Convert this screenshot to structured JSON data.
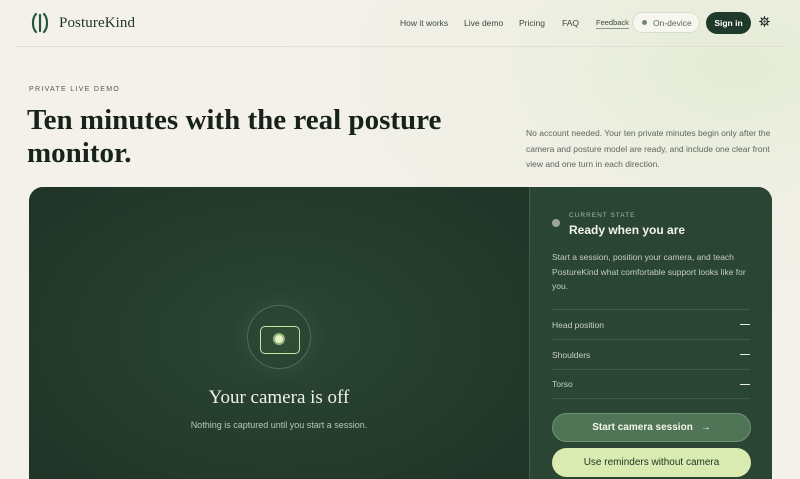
{
  "brand": {
    "name": "PostureKind"
  },
  "nav": {
    "links": [
      "How it works",
      "Live demo",
      "Pricing",
      "FAQ"
    ],
    "feedback": "Feedback",
    "status_badge": "On-device",
    "signin": "Sign in",
    "settings_icon": "gear-icon"
  },
  "hero": {
    "eyebrow": "PRIVATE LIVE DEMO",
    "headline": "Ten minutes with the real posture monitor.",
    "subtext": "No account needed. Your ten private minutes begin only after the camera and posture model are ready, and include one clear front view and one turn in each direction."
  },
  "camera": {
    "icon": "camera-icon",
    "title": "Your camera is off",
    "subtitle": "Nothing is captured until you start a session."
  },
  "state": {
    "label": "CURRENT STATE",
    "title": "Ready when you are",
    "description": "Start a session, position your camera, and teach PostureKind what comfortable support looks like for you."
  },
  "metrics": [
    {
      "label": "Head position",
      "value": "—"
    },
    {
      "label": "Shoulders",
      "value": "—"
    },
    {
      "label": "Torso",
      "value": "—"
    }
  ],
  "actions": {
    "start": "Start camera session",
    "start_arrow": "→",
    "reminders": "Use reminders without camera"
  },
  "colors": {
    "brand_dark": "#1f3a2a",
    "panel": "#243b2d",
    "accent_light": "#d9ebb0"
  }
}
